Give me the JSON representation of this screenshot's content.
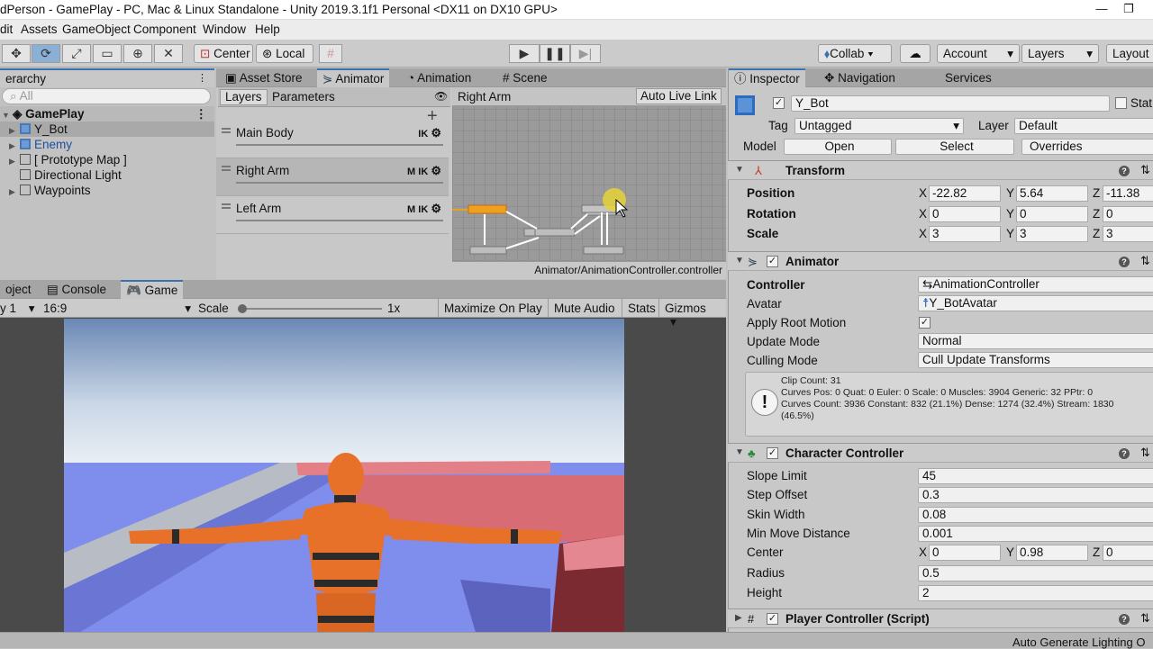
{
  "window": {
    "title": "dPerson - GamePlay - PC, Mac & Linux Standalone - Unity 2019.3.1f1 Personal <DX11 on DX10 GPU>"
  },
  "menu": [
    "dit",
    "Assets",
    "GameObject",
    "Component",
    "Window",
    "Help"
  ],
  "toolbar": {
    "center": "Center",
    "local": "Local",
    "collab": "Collab",
    "account": "Account",
    "layers": "Layers",
    "layout": "Layout"
  },
  "hierarchy": {
    "title": "erarchy",
    "search_placeholder": "All",
    "scene": "GamePlay",
    "items": [
      "Y_Bot",
      "Enemy",
      "[ Prototype Map ]",
      "Directional Light",
      "Waypoints"
    ]
  },
  "center_tabs": [
    "Asset Store",
    "Animator",
    "Animation",
    "Scene"
  ],
  "animator": {
    "tab_layers": "Layers",
    "tab_parameters": "Parameters",
    "breadcrumb": "Right Arm",
    "auto_live": "Auto Live Link",
    "layers": [
      {
        "name": "Main Body",
        "tags": "IK"
      },
      {
        "name": "Right Arm",
        "tags": "M IK"
      },
      {
        "name": "Left Arm",
        "tags": "M IK"
      }
    ],
    "footer": "Animator/AnimationController.controller"
  },
  "bottom_tabs": [
    "oject",
    "Console",
    "Game"
  ],
  "game_bar": {
    "display": "y 1",
    "aspect": "16:9",
    "scale_label": "Scale",
    "scale_value": "1x",
    "maximize": "Maximize On Play",
    "mute": "Mute Audio",
    "stats": "Stats",
    "gizmos": "Gizmos"
  },
  "inspector_tabs": [
    "Inspector",
    "Navigation",
    "Services"
  ],
  "object": {
    "name": "Y_Bot",
    "static": "Stat",
    "tag_label": "Tag",
    "tag": "Untagged",
    "layer_label": "Layer",
    "layer": "Default",
    "model_label": "Model",
    "open": "Open",
    "select": "Select",
    "overrides": "Overrides"
  },
  "transform": {
    "title": "Transform",
    "position_label": "Position",
    "rotation_label": "Rotation",
    "scale_label": "Scale",
    "position": [
      "-22.82",
      "5.64",
      "-11.38"
    ],
    "rotation": [
      "0",
      "0",
      "0"
    ],
    "scale": [
      "3",
      "3",
      "3"
    ]
  },
  "animator_comp": {
    "title": "Animator",
    "controller_label": "Controller",
    "controller": "AnimationController",
    "avatar_label": "Avatar",
    "avatar": "Y_BotAvatar",
    "apply_root": "Apply Root Motion",
    "update_label": "Update Mode",
    "update": "Normal",
    "culling_label": "Culling Mode",
    "culling": "Cull Update Transforms",
    "info": [
      "Clip Count: 31",
      "Curves Pos: 0 Quat: 0 Euler: 0 Scale: 0 Muscles: 3904 Generic: 32 PPtr: 0",
      "Curves Count: 3936 Constant: 832 (21.1%) Dense: 1274 (32.4%) Stream: 1830",
      "(46.5%)"
    ]
  },
  "char_ctrl": {
    "title": "Character Controller",
    "slope_label": "Slope Limit",
    "slope": "45",
    "step_label": "Step Offset",
    "step": "0.3",
    "skin_label": "Skin Width",
    "skin": "0.08",
    "minmove_label": "Min Move Distance",
    "minmove": "0.001",
    "center_label": "Center",
    "center": [
      "0",
      "0.98",
      "0"
    ],
    "radius_label": "Radius",
    "radius": "0.5",
    "height_label": "Height",
    "height": "2"
  },
  "player_ctrl": {
    "title": "Player Controller (Script)"
  },
  "status": {
    "text": "Auto Generate Lighting O"
  }
}
